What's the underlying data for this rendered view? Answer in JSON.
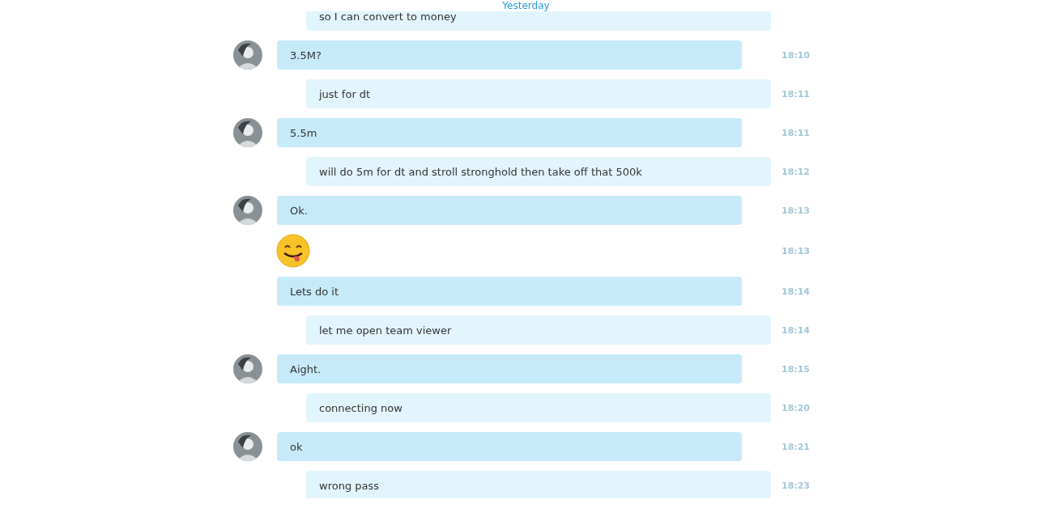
{
  "date_divider": "Yesterday",
  "messages": [
    {
      "kind": "outgoing",
      "text": "so I can convert to money"
    },
    {
      "kind": "incoming",
      "avatar": true,
      "text": "3.5M?",
      "time": "18:10"
    },
    {
      "kind": "outgoing",
      "text": "just for dt",
      "time": "18:11"
    },
    {
      "kind": "incoming",
      "avatar": true,
      "text": "5.5m",
      "time": "18:11"
    },
    {
      "kind": "outgoing",
      "text": "will do 5m for dt and stroll stronghold then take off that 500k",
      "time": "18:12"
    },
    {
      "kind": "incoming",
      "avatar": true,
      "text": "Ok.",
      "time": "18:13"
    },
    {
      "kind": "emoji",
      "avatar": false,
      "time": "18:13"
    },
    {
      "kind": "incoming",
      "avatar": false,
      "text": "Lets do it",
      "time": "18:14"
    },
    {
      "kind": "outgoing",
      "text": "let me open team viewer",
      "time": "18:14"
    },
    {
      "kind": "incoming",
      "avatar": true,
      "text": "Aight.",
      "time": "18:15"
    },
    {
      "kind": "outgoing",
      "text": "connecting now",
      "time": "18:20"
    },
    {
      "kind": "incoming",
      "avatar": true,
      "text": "ok",
      "time": "18:21"
    },
    {
      "kind": "outgoing",
      "text": "wrong pass",
      "time": "18:23"
    }
  ]
}
